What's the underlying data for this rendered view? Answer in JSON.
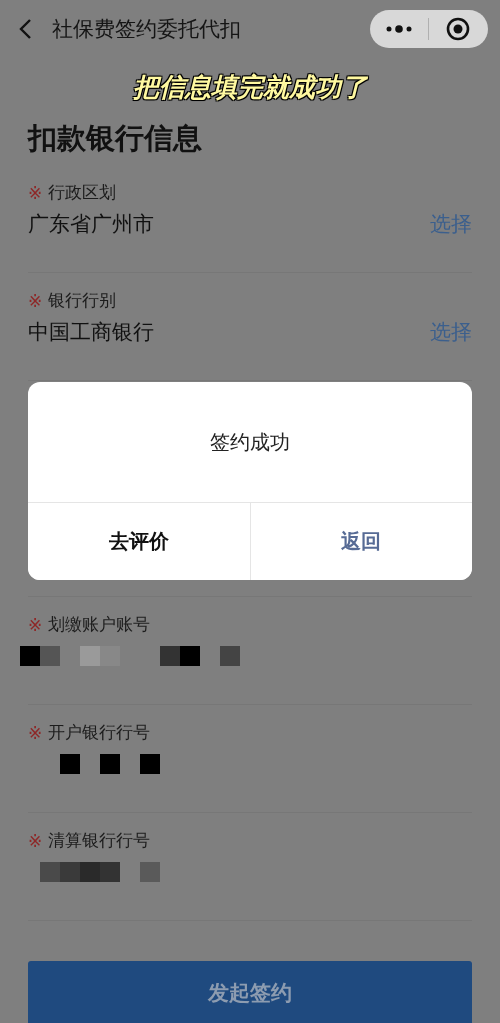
{
  "nav": {
    "title": "社保费签约委托代扣"
  },
  "caption": "把信息填完就成功了",
  "section_title": "扣款银行信息",
  "fields": [
    {
      "required_mark": "※",
      "label": "行政区划",
      "value": "广东省广州市",
      "action": "选择"
    },
    {
      "required_mark": "※",
      "label": "银行行别",
      "value": "中国工商银行",
      "action": "选择"
    },
    {
      "required_mark": "※",
      "label": "划缴账户账号",
      "redacted": true
    },
    {
      "required_mark": "※",
      "label": "开户银行行号",
      "redacted": true
    },
    {
      "required_mark": "※",
      "label": "清算银行行号",
      "redacted": true
    }
  ],
  "dialog": {
    "message": "签约成功",
    "buttons": [
      {
        "label": "去评价",
        "kind": "default"
      },
      {
        "label": "返回",
        "kind": "primary"
      }
    ]
  },
  "submit_button": "发起签约"
}
